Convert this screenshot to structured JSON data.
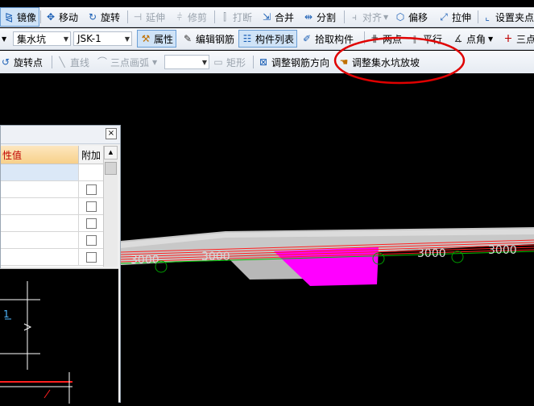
{
  "toolbar_row1": {
    "mirror": "镜像",
    "move": "移动",
    "rotate": "旋转",
    "extend": "延伸",
    "trim": "修剪",
    "break": "打断",
    "merge": "合并",
    "split": "分割",
    "align": "对齐",
    "offset": "偏移",
    "stretch": "拉伸",
    "set_grip": "设置夹点"
  },
  "toolbar_row2": {
    "component_type": "集水坑",
    "component_name": "JSK-1",
    "properties": "属性",
    "edit_rebar": "编辑钢筋",
    "component_list": "构件列表",
    "pick_component": "拾取构件",
    "two_points": "两点",
    "parallel": "平行",
    "point_angle": "点角",
    "three_points": "三点"
  },
  "toolbar_row3": {
    "rotate_point": "旋转点",
    "line": "直线",
    "three_point_arc": "三点画弧",
    "rectangle": "矩形",
    "adjust_rebar_direction": "调整钢筋方向",
    "adjust_pit_slope": "调整集水坑放坡"
  },
  "property_panel": {
    "col_value": "性值",
    "col_extra": "附加",
    "rows": 6
  },
  "scene_labels": {
    "dim_a": "3000",
    "dim_b": "3000",
    "dim_c": "3000",
    "dim_d": "3000",
    "axis_marker": "1"
  },
  "colors": {
    "canvas": "#000000",
    "slab": "#c8c8c8",
    "pit": "#ff00ff",
    "rebar": "#ff2020",
    "highlight": "#e00000"
  }
}
